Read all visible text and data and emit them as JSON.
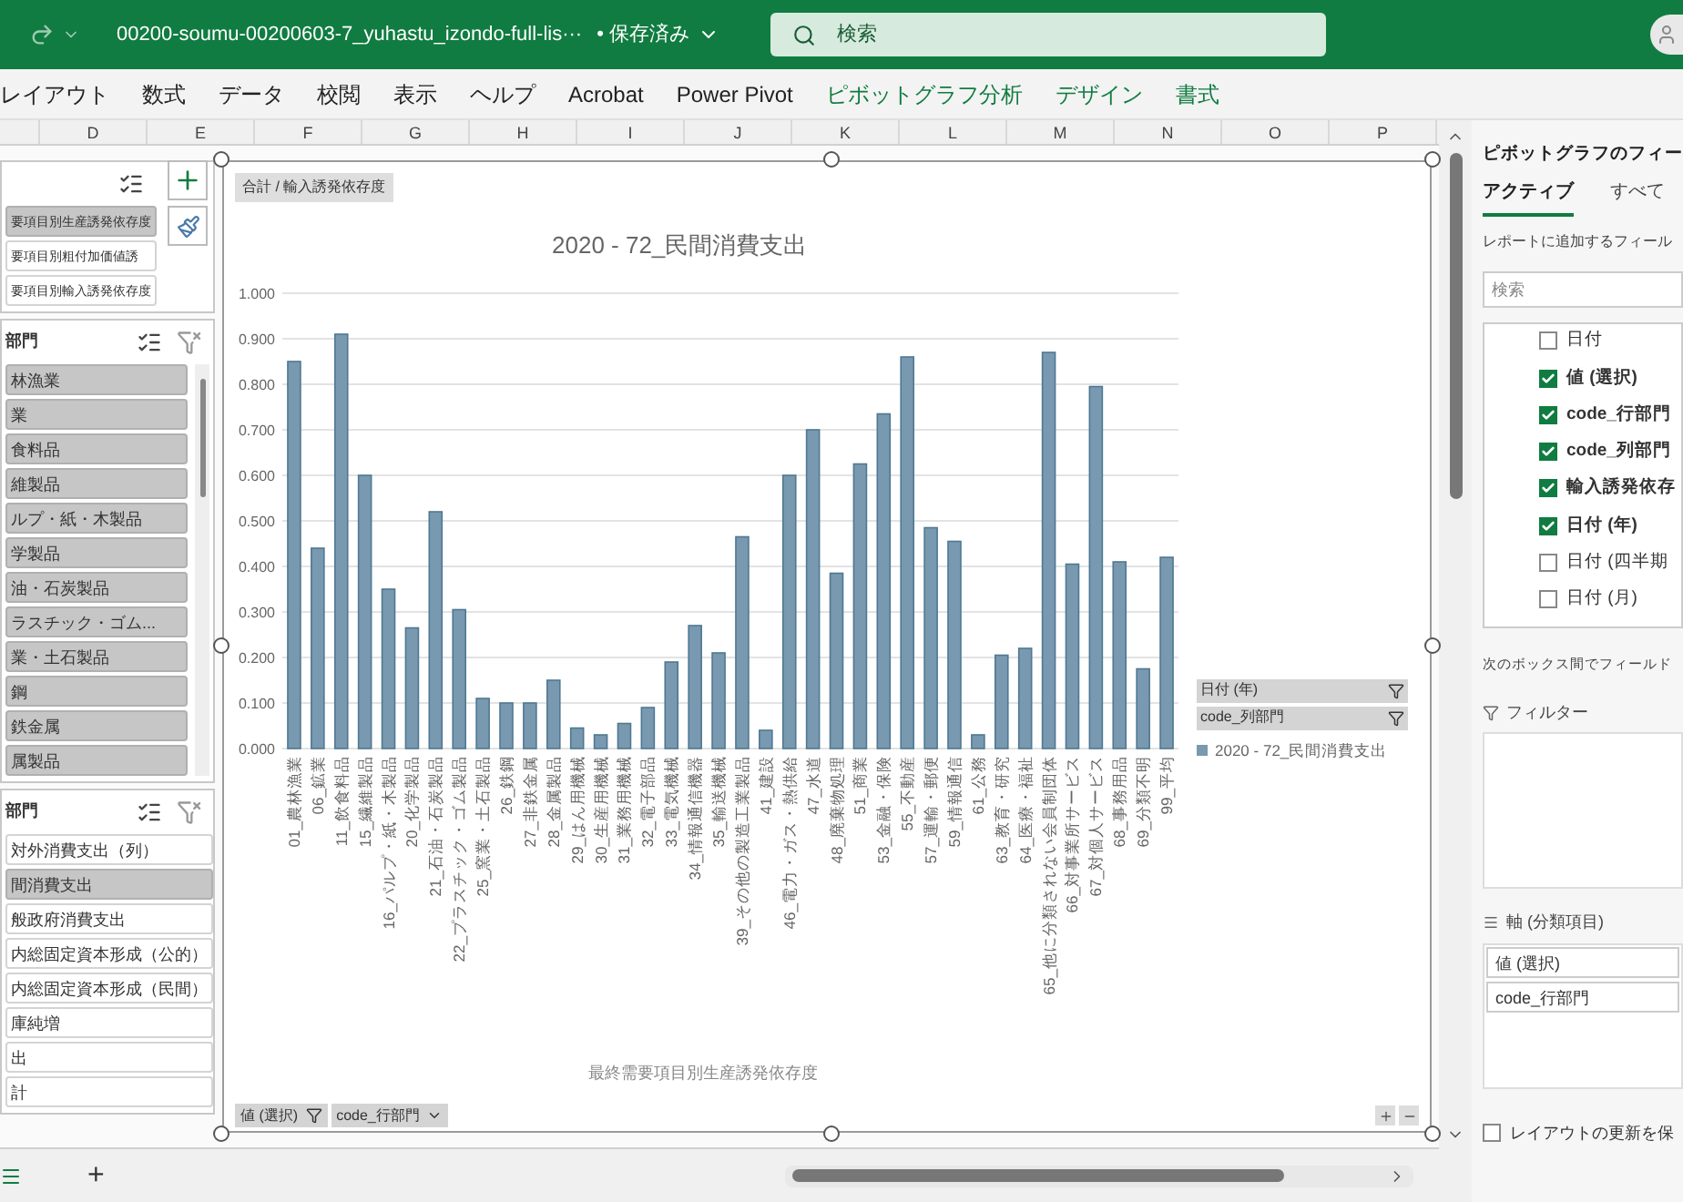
{
  "title_bar": {
    "filename": "00200-soumu-00200603-7_yuhastu_izondo-full-lis···",
    "save_status": "• 保存済み",
    "search_placeholder": "検索"
  },
  "ribbon_tabs": [
    {
      "label": "レイアウト",
      "contextual": false
    },
    {
      "label": "数式",
      "contextual": false
    },
    {
      "label": "データ",
      "contextual": false
    },
    {
      "label": "校閲",
      "contextual": false
    },
    {
      "label": "表示",
      "contextual": false
    },
    {
      "label": "ヘルプ",
      "contextual": false
    },
    {
      "label": "Acrobat",
      "contextual": false
    },
    {
      "label": "Power Pivot",
      "contextual": false
    },
    {
      "label": "ピボットグラフ分析",
      "contextual": true
    },
    {
      "label": "デザイン",
      "contextual": true
    },
    {
      "label": "書式",
      "contextual": true
    }
  ],
  "columns": [
    "D",
    "E",
    "F",
    "G",
    "H",
    "I",
    "J",
    "K",
    "L",
    "M",
    "N",
    "O",
    "P"
  ],
  "slicers": [
    {
      "items": [
        {
          "label": "要項目別生産誘発依存度",
          "selected": true
        },
        {
          "label": "要項目別粗付加価値誘",
          "selected": false
        },
        {
          "label": "要項目別輸入誘発依存度",
          "selected": false
        }
      ]
    },
    {
      "header": "部門",
      "items": [
        {
          "label": "林漁業",
          "selected": true
        },
        {
          "label": "業",
          "selected": true
        },
        {
          "label": "食料品",
          "selected": true
        },
        {
          "label": "維製品",
          "selected": true
        },
        {
          "label": "ルプ・紙・木製品",
          "selected": true
        },
        {
          "label": "学製品",
          "selected": true
        },
        {
          "label": "油・石炭製品",
          "selected": true
        },
        {
          "label": "ラスチック・ゴム...",
          "selected": true
        },
        {
          "label": "業・土石製品",
          "selected": true
        },
        {
          "label": "鋼",
          "selected": true
        },
        {
          "label": "鉄金属",
          "selected": true
        },
        {
          "label": "属製品",
          "selected": true
        }
      ]
    },
    {
      "header": "部門",
      "items": [
        {
          "label": "対外消費支出（列）",
          "selected": false
        },
        {
          "label": "間消費支出",
          "selected": true
        },
        {
          "label": "般政府消費支出",
          "selected": false
        },
        {
          "label": "内総固定資本形成（公的）",
          "selected": false
        },
        {
          "label": "内総固定資本形成（民間）",
          "selected": false
        },
        {
          "label": "庫純増",
          "selected": false
        },
        {
          "label": "出",
          "selected": false
        },
        {
          "label": "計",
          "selected": false
        }
      ]
    }
  ],
  "chart": {
    "field_button": "合計 / 輸入誘発依存度",
    "axis_buttons": [
      "値 (選択)",
      "code_行部門"
    ],
    "legend_buttons": [
      "日付 (年)",
      "code_列部門"
    ],
    "chart_data": {
      "type": "bar",
      "title": "2020 - 72_民間消費支出",
      "xlabel": "最終需要項目別生産誘発依存度",
      "categories": [
        "01_農林漁業",
        "06_鉱業",
        "11_飲食料品",
        "15_繊維製品",
        "16_パルプ・紙・木製品",
        "20_化学製品",
        "21_石油・石炭製品",
        "22_プラスチック・ゴム製品",
        "25_窯業・土石製品",
        "26_鉄鋼",
        "27_非鉄金属",
        "28_金属製品",
        "29_はん用機械",
        "30_生産用機械",
        "31_業務用機械",
        "32_電子部品",
        "33_電気機械",
        "34_情報通信機器",
        "35_輸送機械",
        "39_その他の製造工業製品",
        "41_建設",
        "46_電力・ガス・熱供給",
        "47_水道",
        "48_廃棄物処理",
        "51_商業",
        "53_金融・保険",
        "55_不動産",
        "57_運輸・郵便",
        "59_情報通信",
        "61_公務",
        "63_教育・研究",
        "64_医療・福祉",
        "65_他に分類されない会員制団体",
        "66_対事業所サービス",
        "67_対個人サービス",
        "68_事務用品",
        "69_分類不明",
        "99_平均"
      ],
      "series": [
        {
          "name": "2020 - 72_民間消費支出",
          "color": "#7899b0",
          "values": [
            0.85,
            0.44,
            0.91,
            0.6,
            0.35,
            0.265,
            0.52,
            0.305,
            0.11,
            0.1,
            0.1,
            0.15,
            0.045,
            0.03,
            0.055,
            0.09,
            0.19,
            0.27,
            0.21,
            0.465,
            0.04,
            0.6,
            0.7,
            0.385,
            0.625,
            0.735,
            0.86,
            0.485,
            0.455,
            0.03,
            0.205,
            0.22,
            0.87,
            0.405,
            0.795,
            0.41,
            0.175,
            0.42
          ]
        }
      ],
      "ylim": [
        0,
        1
      ],
      "grid": true,
      "yticks": [
        {
          "value": 0,
          "label": "0.000"
        },
        {
          "value": 0.1,
          "label": "0.100"
        },
        {
          "value": 0.2,
          "label": "0.200"
        },
        {
          "value": 0.3,
          "label": "0.300"
        },
        {
          "value": 0.4,
          "label": "0.400"
        },
        {
          "value": 0.5,
          "label": "0.500"
        },
        {
          "value": 0.6,
          "label": "0.600"
        },
        {
          "value": 0.7,
          "label": "0.700"
        },
        {
          "value": 0.8,
          "label": "0.800"
        },
        {
          "value": 0.9,
          "label": "0.900"
        },
        {
          "value": 1,
          "label": "1.000"
        }
      ]
    }
  },
  "field_pane": {
    "title": "ピボットグラフのフィー",
    "tabs": [
      {
        "label": "アクティブ",
        "selected": true
      },
      {
        "label": "すべて",
        "selected": false
      }
    ],
    "hint": "レポートに追加するフィール",
    "search_placeholder": "検索",
    "fields": [
      {
        "label": "日付",
        "checked": false
      },
      {
        "label": "値 (選択)",
        "checked": true
      },
      {
        "label": "code_行部門",
        "checked": true
      },
      {
        "label": "code_列部門",
        "checked": true
      },
      {
        "label": "輸入誘発依存",
        "checked": true
      },
      {
        "label": "日付 (年)",
        "checked": true
      },
      {
        "label": "日付 (四半期",
        "checked": false
      },
      {
        "label": "日付 (月)",
        "checked": false
      }
    ],
    "areas_hint": "次のボックス間でフィールド",
    "filter_label": "フィルター",
    "axis_label": "軸 (分類項目)",
    "axis_fields": [
      "値 (選択)",
      "code_行部門"
    ],
    "defer_update": {
      "label": "レイアウトの更新を保",
      "checked": false
    }
  },
  "sheet_bar": {
    "add_label": "+"
  }
}
